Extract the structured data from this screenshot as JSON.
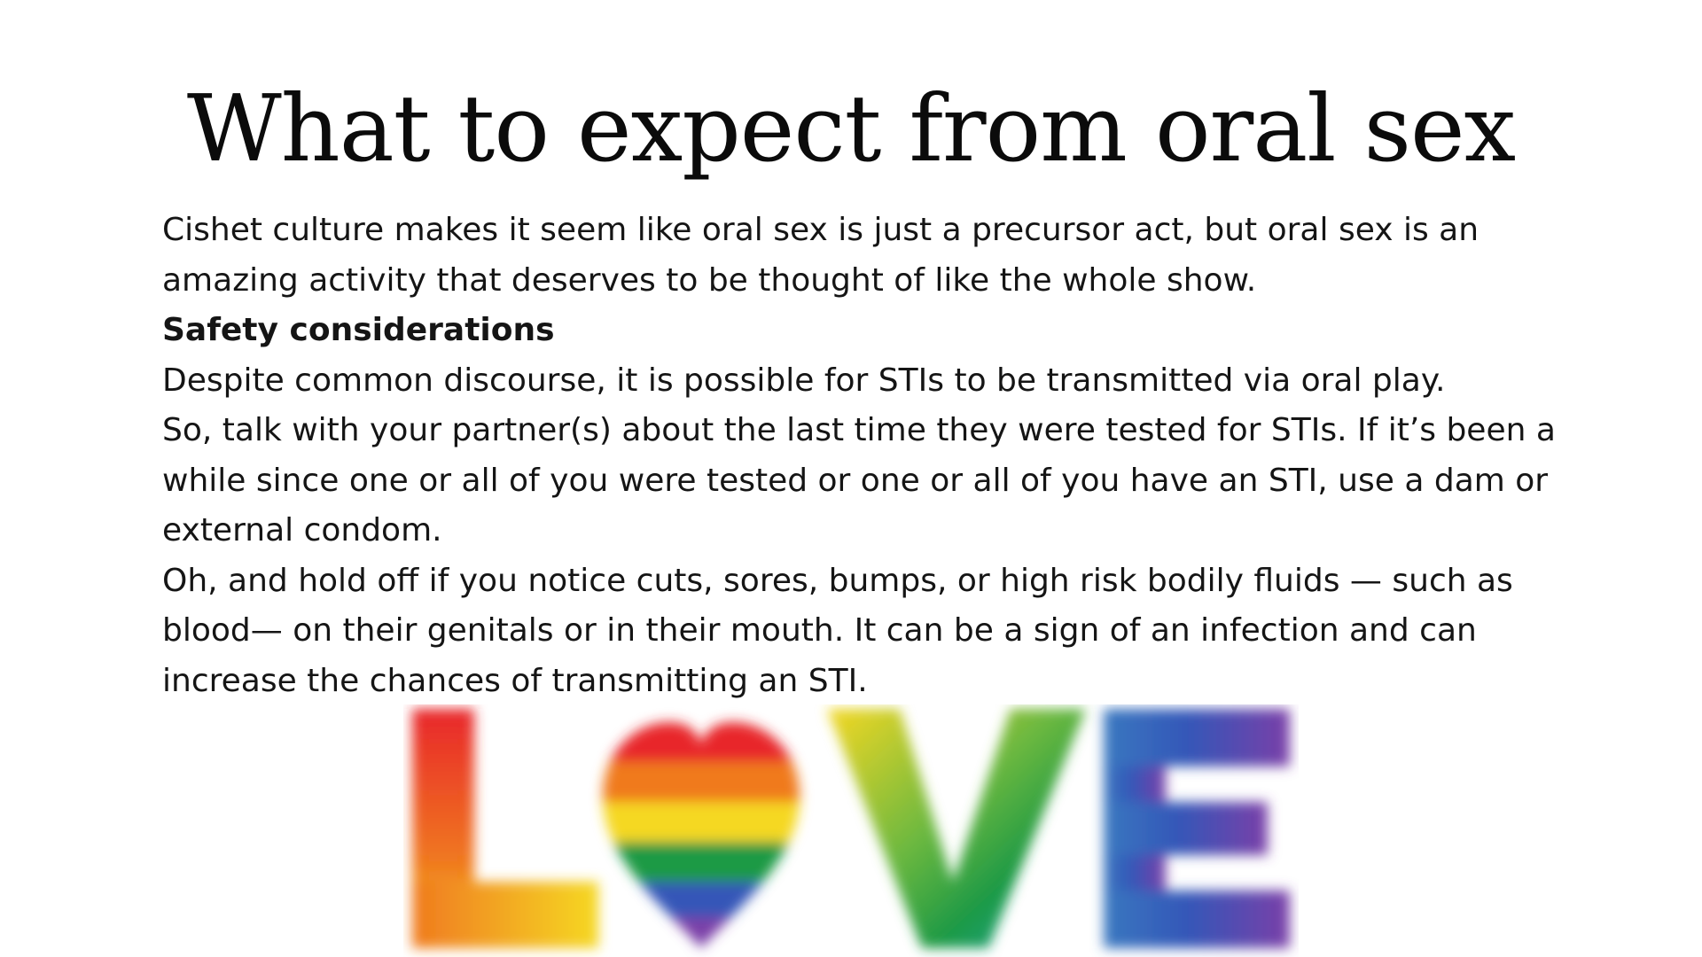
{
  "slide": {
    "title": "What to expect from oral sex",
    "intro": "Cishet culture makes it seem like oral sex is just a precursor act, but oral sex is an amazing activity that deserves to be thought of like the whole show.",
    "safety_heading": "Safety considerations",
    "safety_p1": "Despite common discourse, it is possible for STIs to be transmitted via oral play.",
    "safety_p2": "So, talk with your partner(s) about the last time they were tested for STIs. If it’s been a while since one or all of you were tested or one or all of you have an STI, use a dam or external condom.",
    "safety_p3": "Oh, and hold off if you notice cuts, sores, bumps, or high risk bodily fluids — such as blood— on their genitals or in their mouth. It can be a sign of an infection and can increase the chances of transmitting an STI.",
    "graphic": {
      "letters": [
        "L",
        "V",
        "E"
      ],
      "heart_icon": "rainbow-heart-icon",
      "colors": {
        "red": "#e8262b",
        "orange": "#f07a1f",
        "yellow": "#f5d823",
        "green": "#1f9a45",
        "teal": "#1aa6a8",
        "blue": "#3457b8",
        "indigo": "#4b3aa6",
        "purple": "#7a3fa8"
      }
    }
  }
}
